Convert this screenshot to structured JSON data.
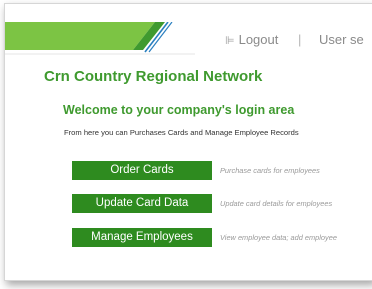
{
  "header": {
    "logout_label": "Logout",
    "separator": "|",
    "user_settings_label": "User se",
    "brand_colors": {
      "green": "#3f9a2f",
      "light_green": "#7cc444",
      "accent_blue": "#2a7fc0"
    }
  },
  "main": {
    "network_title": "Crn Country Regional Network",
    "welcome_heading": "Welcome to your company's login area",
    "intro_text": "From here you can Purchases Cards and Manage Employee Records",
    "actions": [
      {
        "label": "Order Cards",
        "description": "Purchase cards for employees"
      },
      {
        "label": "Update Card Data",
        "description": "Update card details for employees"
      },
      {
        "label": "Manage Employees",
        "description": "View employee data; add employee"
      }
    ]
  }
}
